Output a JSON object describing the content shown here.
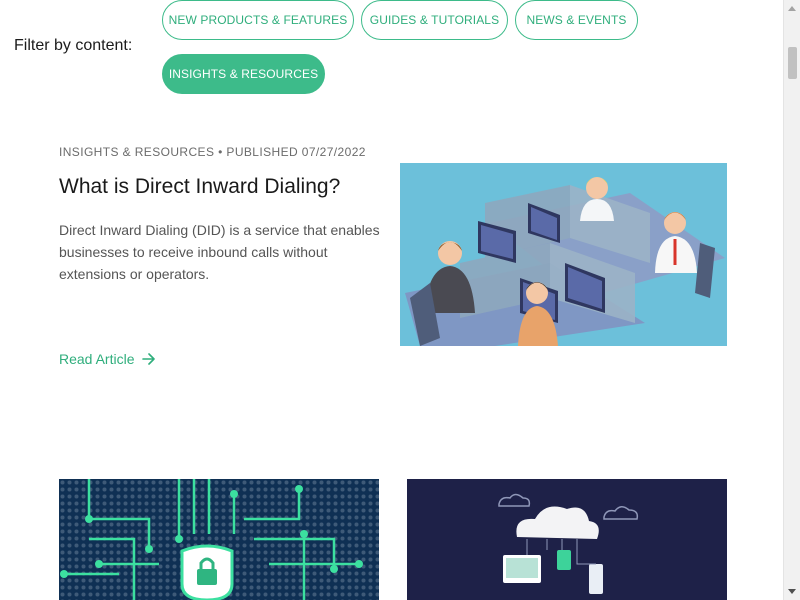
{
  "filter": {
    "label": "Filter by content:",
    "chips": [
      {
        "label": "NEW PRODUCTS & FEATURES",
        "active": false
      },
      {
        "label": "GUIDES & TUTORIALS",
        "active": false
      },
      {
        "label": "NEWS & EVENTS",
        "active": false
      },
      {
        "label": "INSIGHTS & RESOURCES",
        "active": true
      }
    ]
  },
  "featured": {
    "meta": "INSIGHTS & RESOURCES • PUBLISHED 07/27/2022",
    "title": "What is Direct Inward Dialing?",
    "excerpt": "Direct Inward Dialing (DID) is a service that enables businesses to receive inbound calls without extensions or operators.",
    "read_more": "Read Article",
    "read_more_icon": "arrow-right-icon",
    "image_icon": "call-center-illustration"
  },
  "cards": [
    {
      "image_icon": "security-lock-circuit-illustration"
    },
    {
      "image_icon": "cloud-devices-illustration"
    }
  ],
  "colors": {
    "accent": "#3dbb8a",
    "hero_bg": "#6cc0da",
    "card1_bg": "#0f3054",
    "card2_bg": "#1e2148"
  }
}
